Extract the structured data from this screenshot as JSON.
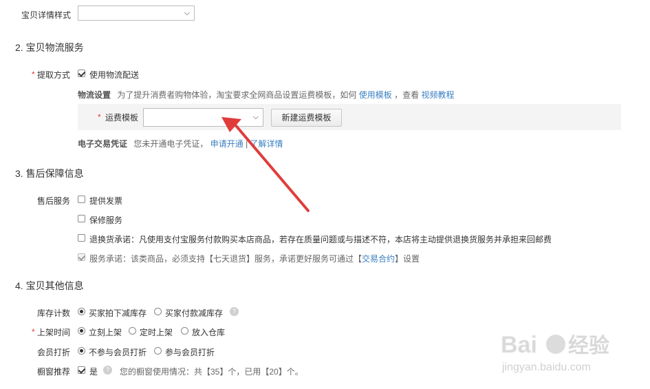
{
  "detail_style": {
    "label": "宝贝详情样式",
    "value": ""
  },
  "section2": {
    "title": "2. 宝贝物流服务",
    "pickup": {
      "required_mark": "*",
      "label": "提取方式",
      "option": "使用物流配送",
      "checked": true
    },
    "logistics": {
      "label": "物流设置",
      "text": "为了提升消费者购物体验，淘宝要求全网商品设置运费模板，如何",
      "link1": "使用模板",
      "sep": "，查看",
      "link2": "视频教程"
    },
    "freight": {
      "required_mark": "*",
      "label": "运费模板",
      "value": "",
      "new_button": "新建运费模板"
    },
    "e_voucher": {
      "label": "电子交易凭证",
      "text": "您未开通电子凭证，",
      "link1": "申请开通",
      "sep": "|",
      "link2": "了解详情"
    }
  },
  "section3": {
    "title": "3. 售后保障信息",
    "label": "售后服务",
    "items": [
      {
        "text": "提供发票",
        "checked": false,
        "disabled": false
      },
      {
        "text": "保修服务",
        "checked": false,
        "disabled": false
      },
      {
        "text": "退换货承诺：凡使用支付宝服务付款购买本店商品，若存在质量问题或与描述不符，本店将主动提供退换货服务并承担来回邮费",
        "checked": false,
        "disabled": false
      },
      {
        "text_before": "服务承诺：该类商品，必须支持【七天退货】服务，承诺更好服务可通过【",
        "link": "交易合约",
        "text_after": "】设置",
        "checked": true,
        "disabled": true
      }
    ]
  },
  "section4": {
    "title": "4. 宝贝其他信息",
    "inventory": {
      "label": "库存计数",
      "options": [
        "买家拍下减库存",
        "买家付款减库存"
      ],
      "selected": 0,
      "help_icon": "?"
    },
    "listing": {
      "required_mark": "*",
      "label": "上架时间",
      "options": [
        "立刻上架",
        "定时上架",
        "放入仓库"
      ],
      "selected": 0
    },
    "member_discount": {
      "label": "会员打折",
      "options": [
        "不参与会员打折",
        "参与会员打折"
      ],
      "selected": 0
    },
    "window": {
      "label": "橱窗推荐",
      "option": "是",
      "checked": true,
      "help_icon": "?",
      "info": "您的橱窗使用情况：共【35】个，已用【20】个。"
    }
  },
  "watermark": {
    "text": "Bai经验",
    "url": "jingyan.baidu.com"
  },
  "colors": {
    "link": "#3a7fc1",
    "required": "#e4393c",
    "arrow": "#e03c3c"
  }
}
